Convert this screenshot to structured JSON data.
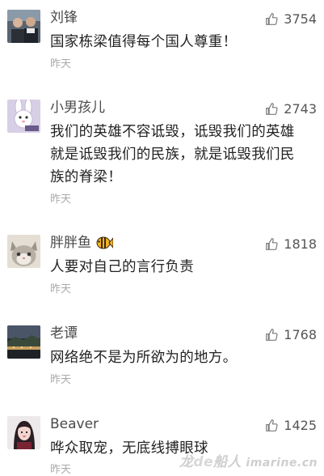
{
  "comments": [
    {
      "user": "刘锋",
      "likes": "3754",
      "text": "国家栋梁值得每个国人尊重！",
      "time": "昨天"
    },
    {
      "user": "小男孩儿",
      "likes": "2743",
      "text": "我们的英雄不容诋毁，诋毁我们的英雄\n就是诋毁我们的民族，就是诋毁我们民\n族的脊梁！",
      "time": "昨天"
    },
    {
      "user": "胖胖鱼",
      "likes": "1818",
      "text": "人要对自己的言行负责",
      "time": "昨天"
    },
    {
      "user": "老谭",
      "likes": "1768",
      "text": "网络绝不是为所欲为的地方。",
      "time": "昨天"
    },
    {
      "user": "Beaver",
      "likes": "1425",
      "text": "哗众取宠，无底线搏眼球",
      "time": "昨天"
    }
  ],
  "watermark": {
    "part1": "龙",
    "part2": "de",
    "part3": "船人",
    "part4": " imarine.cn"
  },
  "icons": {
    "like": "thumbs-up-icon",
    "fish": "fish-emoji-icon"
  },
  "colors": {
    "like_icon": "#7a7a7a",
    "time": "#aaaaaa",
    "text": "#222222"
  }
}
